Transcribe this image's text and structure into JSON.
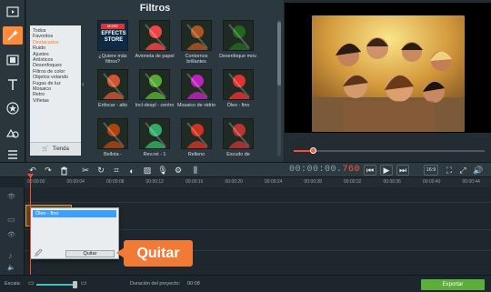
{
  "filters_panel": {
    "title": "Filtros",
    "categories": [
      {
        "label": "Todos"
      },
      {
        "label": "Favoritos"
      },
      {
        "label": "Destacados",
        "selected": true
      },
      {
        "label": "Ruido"
      },
      {
        "label": "Ajustes"
      },
      {
        "label": "Artísticos"
      },
      {
        "label": "Desenfoques"
      },
      {
        "label": "Filtros de color"
      },
      {
        "label": "Objetos volando"
      },
      {
        "label": "Fugas de luz"
      },
      {
        "label": "Mosaico"
      },
      {
        "label": "Retro"
      },
      {
        "label": "Viñetas"
      }
    ],
    "shop_label": "Tienda",
    "thumbnails": [
      {
        "label": "¿Quiere más filtros?",
        "store_top": "MORE",
        "store_line1": "EFFECTS",
        "store_line2": "STORE"
      },
      {
        "label": "Avioneta de papel"
      },
      {
        "label": "Contornos brillantes"
      },
      {
        "label": "Desenfoque mov."
      },
      {
        "label": "Enfocar - alto"
      },
      {
        "label": "Incl-despl - centro"
      },
      {
        "label": "Mosaico de vidrio"
      },
      {
        "label": "Óleo - fino"
      },
      {
        "label": "Bellota -"
      },
      {
        "label": "Rev.ret - 1"
      },
      {
        "label": "Relleno"
      },
      {
        "label": "Escudo de"
      }
    ]
  },
  "timeline_toolbar": {
    "timecode_main": "00:00:00.",
    "timecode_ms": "760",
    "aspect_label": "16:9"
  },
  "ruler_labels": [
    "00:00:00",
    "00:00:04",
    "00:00:08",
    "00:00:12",
    "00:00:16",
    "00:00:20",
    "00:00:24",
    "00:00:28",
    "00:00:32",
    "00:00:36",
    "00:00:40",
    "00:00:44"
  ],
  "clip": {
    "applied_filter": "Óleo - fino"
  },
  "popup": {
    "selected_item": "Óleo - fino",
    "remove_button": "Quitar"
  },
  "callout": {
    "text": "Quitar"
  },
  "bottom_bar": {
    "scale_label": "Escala:",
    "duration_label": "Duración del proyecto:",
    "duration_value": "00:08",
    "export_label": "Exportar"
  },
  "preview": {
    "playback_fraction": 0.11
  },
  "colors": {
    "accent": "#ff8a3c",
    "playhead": "#ff4a2a",
    "export": "#5cae3a",
    "selection": "#3ca0ff",
    "callout": "#f07a36"
  },
  "tools_icons": [
    "import-icon",
    "magic-wand-icon",
    "filmstrip-icon",
    "text-icon",
    "star-icon",
    "shapes-icon",
    "list-icon"
  ]
}
